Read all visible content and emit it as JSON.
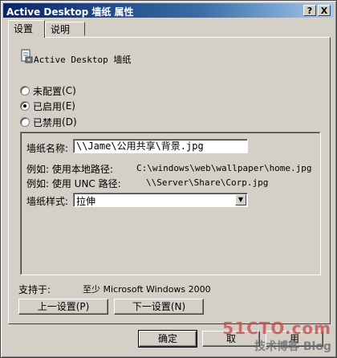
{
  "window": {
    "title": "Active Desktop 墙纸 属性",
    "help_btn": "?",
    "close_btn": "X"
  },
  "tabs": [
    {
      "label": "设置"
    },
    {
      "label": "说明"
    }
  ],
  "header": {
    "label": "Active Desktop 墙纸",
    "icon": "policy-icon"
  },
  "radios": [
    {
      "label": "未配置",
      "key": "(C)",
      "checked": false
    },
    {
      "label": "已启用",
      "key": "(E)",
      "checked": true
    },
    {
      "label": "已禁用",
      "key": "(D)",
      "checked": false
    }
  ],
  "options": {
    "wallpaper_name_label": "墙纸名称:",
    "wallpaper_name_value": "\\\\Jame\\公用共享\\背景.jpg",
    "example1_label": "例如: 使用本地路径:",
    "example1_value": "C:\\windows\\web\\wallpaper\\home.jpg",
    "example2_label": "例如: 使用 UNC 路径:",
    "example2_value": "\\\\Server\\Share\\Corp.jpg",
    "style_label": "墙纸样式:",
    "style_value": "拉伸"
  },
  "support": {
    "label": "支持于:",
    "value": "至少 Microsoft Windows 2000"
  },
  "nav_buttons": {
    "prev": "上一设置(P)",
    "next": "下一设置(N)"
  },
  "dialog_buttons": {
    "ok": "确定",
    "cancel": "取",
    "apply": "用"
  },
  "watermark": {
    "line1": "51CTO.com",
    "line2": "技术博客",
    "line3": "Blog"
  }
}
